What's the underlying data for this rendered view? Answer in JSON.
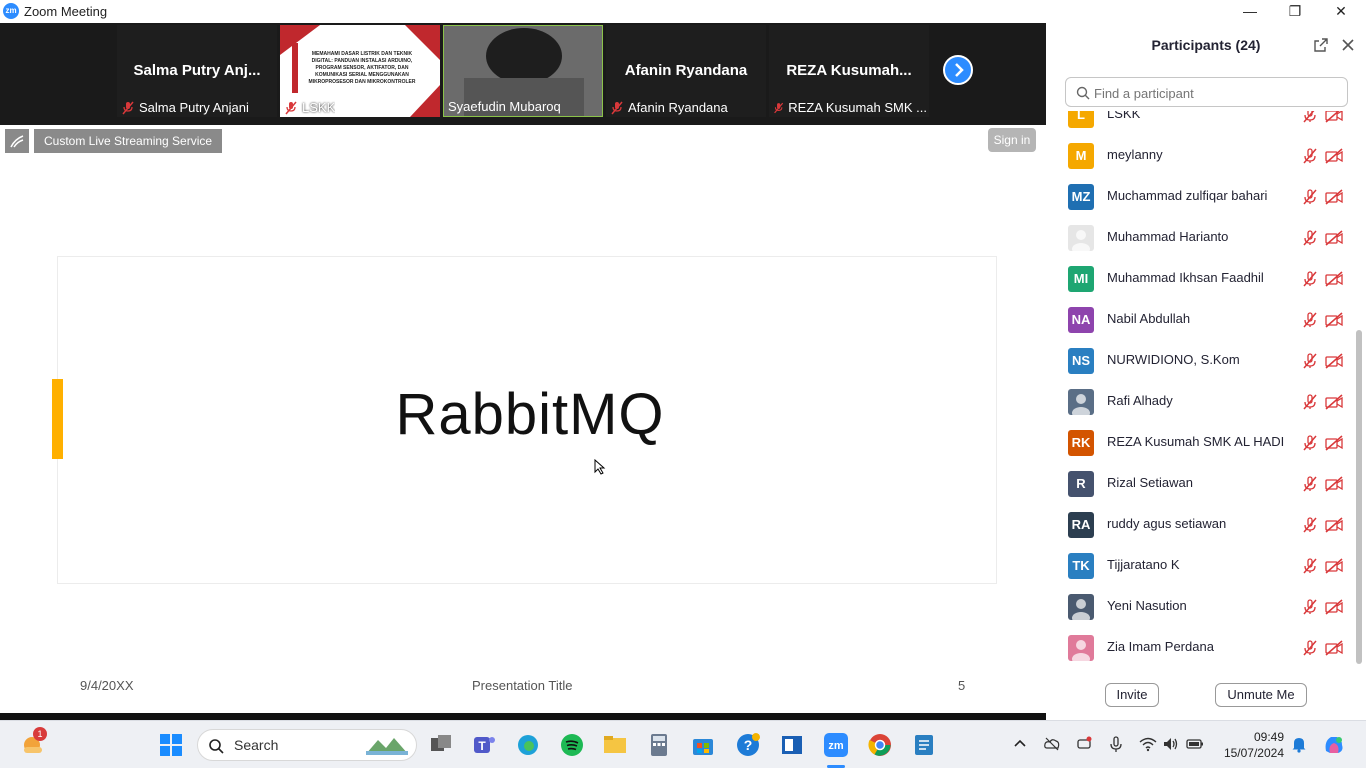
{
  "window": {
    "title": "Zoom Meeting"
  },
  "gallery": {
    "tiles": [
      {
        "big_name": "Salma Putry Anj...",
        "caption": "Salma Putry Anjani"
      },
      {
        "caption": "LSKK",
        "slide_heading": "MEMAHAMI DASAR LISTRIK DAN TEKNIK DIGITAL: PANDUAN INSTALASI ARDUINO, PROGRAM SENSOR, AKTIFATOR, DAN KOMUNIKASI SERIAL MENGGUNAKAN MIKROPROSESOR DAN MIKROKONTROLER"
      },
      {
        "caption": "Syaefudin Mubaroq"
      },
      {
        "big_name": "Afanin Ryandana",
        "caption": "Afanin Ryandana"
      },
      {
        "big_name": "REZA Kusumah...",
        "caption": "REZA Kusumah SMK ..."
      }
    ]
  },
  "share": {
    "live_stream_label": "Custom Live Streaming Service",
    "sign_in": "Sign in",
    "slide_title": "RabbitMQ",
    "footer_date": "9/4/20XX",
    "footer_title": "Presentation Title",
    "footer_page": "5"
  },
  "participants": {
    "title": "Participants (24)",
    "search_placeholder": "Find a participant",
    "list": [
      {
        "initials": "L",
        "name": "LSKK",
        "color": "#f5a800"
      },
      {
        "initials": "M",
        "name": "meylanny",
        "color": "#f5a800"
      },
      {
        "initials": "MZ",
        "name": "Muchammad zulfiqar bahari",
        "color": "#1f6fb2"
      },
      {
        "initials": "",
        "name": "Muhammad Harianto",
        "color": "#e6e6e6"
      },
      {
        "initials": "MI",
        "name": "Muhammad Ikhsan Faadhil",
        "color": "#1ea672"
      },
      {
        "initials": "NA",
        "name": "Nabil Abdullah",
        "color": "#8e44ad"
      },
      {
        "initials": "NS",
        "name": "NURWIDIONO, S.Kom",
        "color": "#2a7fc1"
      },
      {
        "initials": "",
        "name": "Rafi Alhady",
        "color": "#5a6e86"
      },
      {
        "initials": "RK",
        "name": "REZA Kusumah SMK AL HADI",
        "color": "#d35400"
      },
      {
        "initials": "R",
        "name": "Rizal Setiawan",
        "color": "#45526e"
      },
      {
        "initials": "RA",
        "name": "ruddy agus setiawan",
        "color": "#2c3e50"
      },
      {
        "initials": "TK",
        "name": "Tijjaratano K",
        "color": "#2a7fc1"
      },
      {
        "initials": "",
        "name": "Yeni Nasution",
        "color": "#4a5a70"
      },
      {
        "initials": "",
        "name": "Zia Imam Perdana",
        "color": "#e07a9a"
      }
    ],
    "invite": "Invite",
    "unmute_me": "Unmute Me"
  },
  "taskbar": {
    "search_label": "Search",
    "notification_badge": "1",
    "time": "09:49",
    "date": "15/07/2024"
  },
  "colors": {
    "zoom_blue": "#2d8cff",
    "muted_red": "#d9383a",
    "accent_orange": "#ffb000"
  }
}
